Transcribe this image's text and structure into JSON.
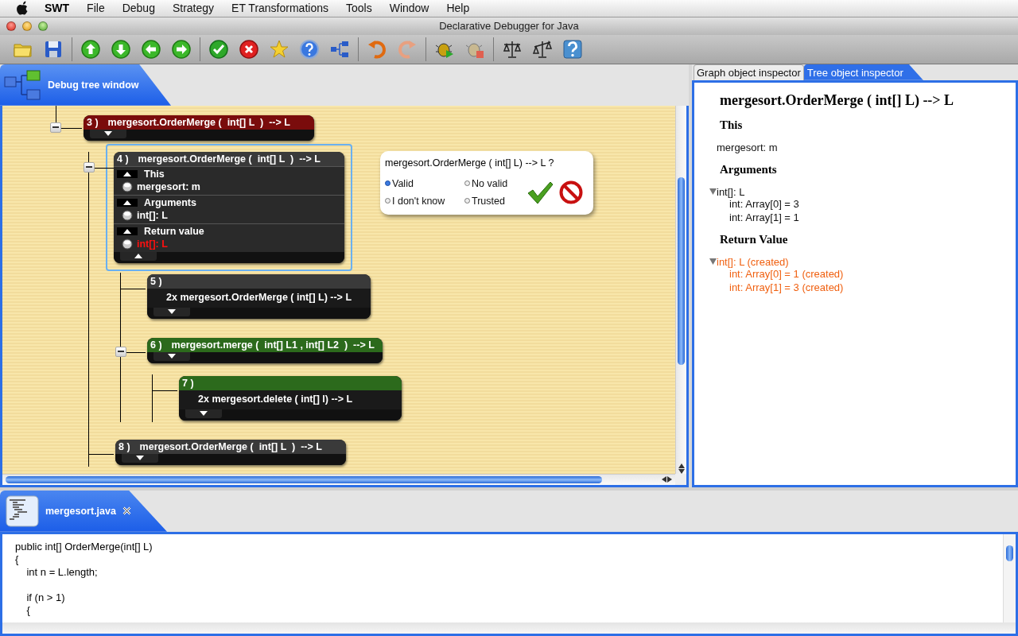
{
  "menu_bar": {
    "app_name": "SWT",
    "items": [
      "File",
      "Debug",
      "Strategy",
      "ET Transformations",
      "Tools",
      "Window",
      "Help"
    ]
  },
  "window": {
    "title": "Declarative Debugger for Java"
  },
  "debug_panel": {
    "tab": {
      "label": "Debug tree window"
    },
    "tree": [
      {
        "kind": "call",
        "number": "3 )",
        "title": "mergesort.OrderMerge (  int[] L  )  --> L",
        "color": "#7a0c0c",
        "selected": false,
        "details_open": false,
        "expanded": true,
        "children": [
          {
            "kind": "call",
            "number": "4 )",
            "title": "mergesort.OrderMerge (  int[] L  )  --> L",
            "color": "#3a3a3a",
            "selected": true,
            "details_open": true,
            "expanded": true,
            "sections": [
              {
                "heading": "This",
                "expanded": true,
                "items": [
                  {
                    "text": "mergesort: m",
                    "highlighted": false
                  }
                ]
              },
              {
                "heading": "Arguments",
                "expanded": true,
                "items": [
                  {
                    "text": "int[]: L",
                    "highlighted": false
                  }
                ]
              },
              {
                "heading": "Return value",
                "expanded": true,
                "items": [
                  {
                    "text": "int[]: L",
                    "highlighted": true
                  }
                ]
              }
            ],
            "children": [
              {
                "kind": "group",
                "number": "5 )",
                "title": "2x mergesort.OrderMerge ( int[] L) --> L",
                "color": "#3a3a3a",
                "selected": false,
                "details_open": false
              },
              {
                "kind": "call",
                "number": "6 )",
                "title": "mergesort.merge (  int[] L1 , int[] L2  )  --> L",
                "color": "#2c6a1c",
                "selected": false,
                "details_open": false,
                "expanded": true,
                "children": [
                  {
                    "kind": "group",
                    "number": "7 )",
                    "title": "2x mergesort.delete ( int[] l) --> L",
                    "color": "#2c6a1c",
                    "selected": false,
                    "details_open": false
                  }
                ]
              }
            ]
          },
          {
            "kind": "call",
            "number": "8 )",
            "title": "mergesort.OrderMerge (  int[] L  )  --> L",
            "color": "#3a3a3a",
            "selected": false,
            "details_open": false
          }
        ]
      }
    ],
    "popup": {
      "question": "mergesort.OrderMerge ( int[] L) --> L ?",
      "options": [
        {
          "label": "Valid",
          "selected": true
        },
        {
          "label": "No valid",
          "selected": false
        },
        {
          "label": "I don't know",
          "selected": false
        },
        {
          "label": "Trusted",
          "selected": false
        }
      ]
    }
  },
  "inspector": {
    "tabs": [
      {
        "label": "Graph object inspector",
        "selected": false
      },
      {
        "label": "Tree object inspector",
        "selected": true
      }
    ],
    "title": "mergesort.OrderMerge ( int[] L) --> L",
    "sections": [
      {
        "heading": "This",
        "items": [
          {
            "text": "mergesort: m",
            "highlighted": false
          }
        ]
      },
      {
        "heading": "Arguments",
        "items": [
          {
            "text": "int[]: L",
            "highlighted": false,
            "expanded": true,
            "children": [
              {
                "text": "int: Array[0] = 3",
                "highlighted": false
              },
              {
                "text": "int: Array[1] = 1",
                "highlighted": false
              }
            ]
          }
        ]
      },
      {
        "heading": "Return Value",
        "items": [
          {
            "text": "int[]: L (created)",
            "highlighted": true,
            "expanded": true,
            "children": [
              {
                "text": "int: Array[0] = 1 (created)",
                "highlighted": true
              },
              {
                "text": "int: Array[1] = 3 (created)",
                "highlighted": true
              }
            ]
          }
        ]
      }
    ]
  },
  "editor": {
    "tab": {
      "label": "mergesort.java"
    },
    "code_blocks": [
      [
        "public int[] OrderMerge(int[] L)",
        "{",
        "    int n = L.length;"
      ],
      [
        "    if (n > 1)",
        "    {"
      ]
    ]
  }
}
